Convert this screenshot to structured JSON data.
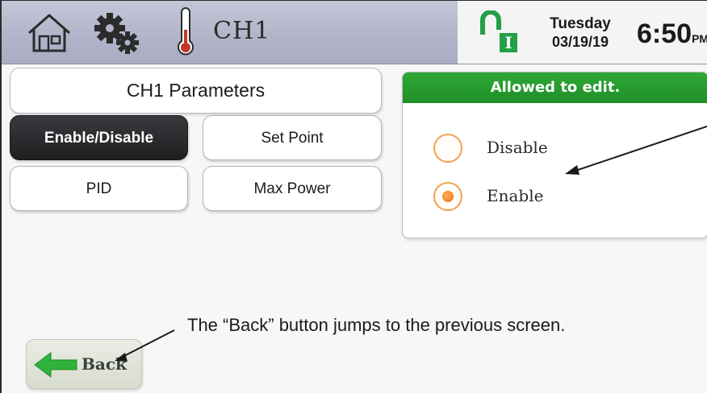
{
  "header": {
    "channel_title": "CH1",
    "lock_label": "I",
    "day": "Tuesday",
    "date": "03/19/19",
    "time": "6:50",
    "ampm": "PM"
  },
  "icons": {
    "home": "home-icon",
    "settings": "gears-icon",
    "thermometer": "thermometer-icon",
    "lock": "padlock-open-icon",
    "back": "arrow-left-icon"
  },
  "parameters": {
    "title": "CH1 Parameters",
    "buttons": [
      {
        "label": "Enable/Disable",
        "active": true
      },
      {
        "label": "Set Point",
        "active": false
      },
      {
        "label": "PID",
        "active": false
      },
      {
        "label": "Max Power",
        "active": false
      }
    ]
  },
  "edit_panel": {
    "header": "Allowed to edit.",
    "options": [
      {
        "label": "Disable",
        "selected": false
      },
      {
        "label": "Enable",
        "selected": true
      }
    ]
  },
  "back_button": {
    "label": "Back"
  },
  "annotation": {
    "back_caption": "The “Back” button jumps to the previous screen."
  },
  "colors": {
    "header_green": "#24a047",
    "radio_orange": "#f26a0d",
    "topbar": "#b1b4c8"
  }
}
